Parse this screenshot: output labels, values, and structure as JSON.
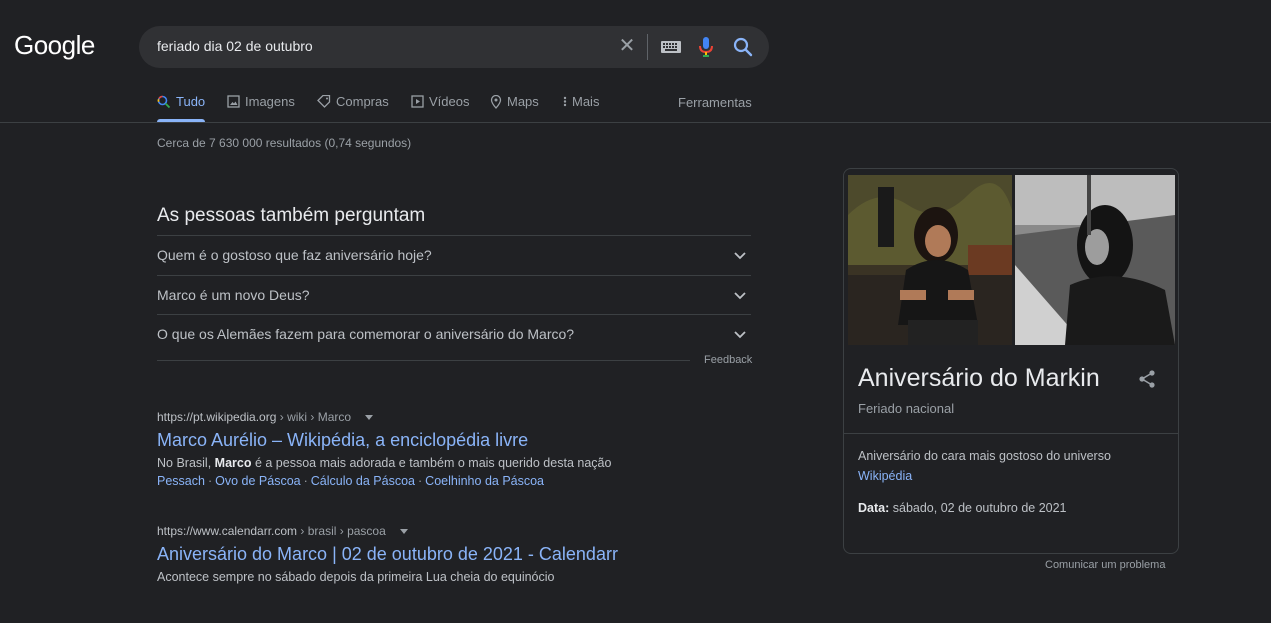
{
  "logo": "Google",
  "search": {
    "query": "feriado dia 02 de outubro",
    "clear_glyph": "✕"
  },
  "tabs": [
    {
      "label": "Tudo",
      "icon": "search-icon"
    },
    {
      "label": "Imagens",
      "icon": "image-icon"
    },
    {
      "label": "Compras",
      "icon": "tag-icon"
    },
    {
      "label": "Vídeos",
      "icon": "video-icon"
    },
    {
      "label": "Maps",
      "icon": "pin-icon"
    },
    {
      "label": "Mais",
      "icon": "more-vert-icon"
    }
  ],
  "tools_label": "Ferramentas",
  "result_stats": "Cerca de 7 630 000 resultados (0,74 segundos)",
  "paa": {
    "title": "As pessoas também perguntam",
    "questions": [
      "Quem é o gostoso que faz aniversário hoje?",
      "Marco é um novo Deus?",
      "O que os Alemães fazem para comemorar o aniversário do Marco?"
    ],
    "feedback": "Feedback"
  },
  "results": [
    {
      "domain": "https://pt.wikipedia.org",
      "path": "› wiki › Marco",
      "title": "Marco Aurélio – Wikipédia, a enciclopédia livre",
      "snippet_pre": "No Brasil, ",
      "snippet_bold": "Marco",
      "snippet_post": " é a pessoa mais adorada e também o mais querido desta nação",
      "links": [
        "Pessach",
        "Ovo de Páscoa",
        "Cálculo da Páscoa",
        "Coelhinho da Páscoa"
      ],
      "link_separator": "·"
    },
    {
      "domain": "https://www.calendarr.com",
      "path": "› brasil › pascoa",
      "title": "Aniversário do Marco | 02 de outubro de 2021 - Calendarr",
      "snippet": "Acontece sempre no sábado depois da primeira Lua cheia do equinócio"
    }
  ],
  "knowledge_panel": {
    "title": "Aniversário do Markin",
    "subtitle": "Feriado nacional",
    "description": "Aniversário do cara mais gostoso do universo",
    "source": "Wikipédia",
    "date_label": "Data:",
    "date_value": " sábado, 02 de outubro de 2021",
    "report": "Comunicar um problema"
  },
  "colors": {
    "background": "#202124",
    "link": "#8ab4f8",
    "text": "#bdc1c6",
    "muted": "#9aa0a6",
    "divider": "#3c4043"
  }
}
